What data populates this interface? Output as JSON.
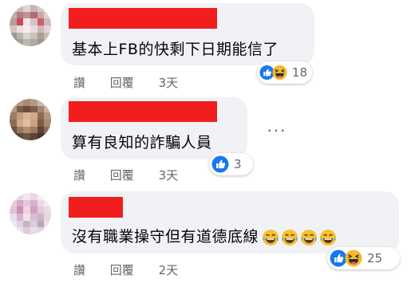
{
  "comments": [
    {
      "text": "基本上FB的快剩下日期能信了",
      "actions": {
        "like": "讚",
        "reply": "回覆",
        "time": "3天"
      },
      "reactions": {
        "count": "18",
        "icons": [
          "like-icon",
          "haha-icon"
        ]
      }
    },
    {
      "text": "算有良知的詐騙人員",
      "actions": {
        "like": "讚",
        "reply": "回覆",
        "time": "3天"
      },
      "reactions": {
        "count": "3",
        "icons": [
          "like-icon"
        ]
      },
      "more": "···"
    },
    {
      "text": "沒有職業操守但有道德底線",
      "emojis": [
        "tears-of-joy-emoji",
        "tears-of-joy-emoji",
        "tears-of-joy-emoji",
        "tears-of-joy-emoji"
      ],
      "actions": {
        "like": "讚",
        "reply": "回覆",
        "time": "2天"
      },
      "reactions": {
        "count": "25",
        "icons": [
          "like-icon",
          "haha-icon"
        ]
      }
    }
  ],
  "colors": {
    "bubble": "#f0f2f5",
    "redaction": "#f21d1d",
    "action_text": "#65676b",
    "like_blue": "#1877f2",
    "haha_yellow": "#f7b928"
  }
}
